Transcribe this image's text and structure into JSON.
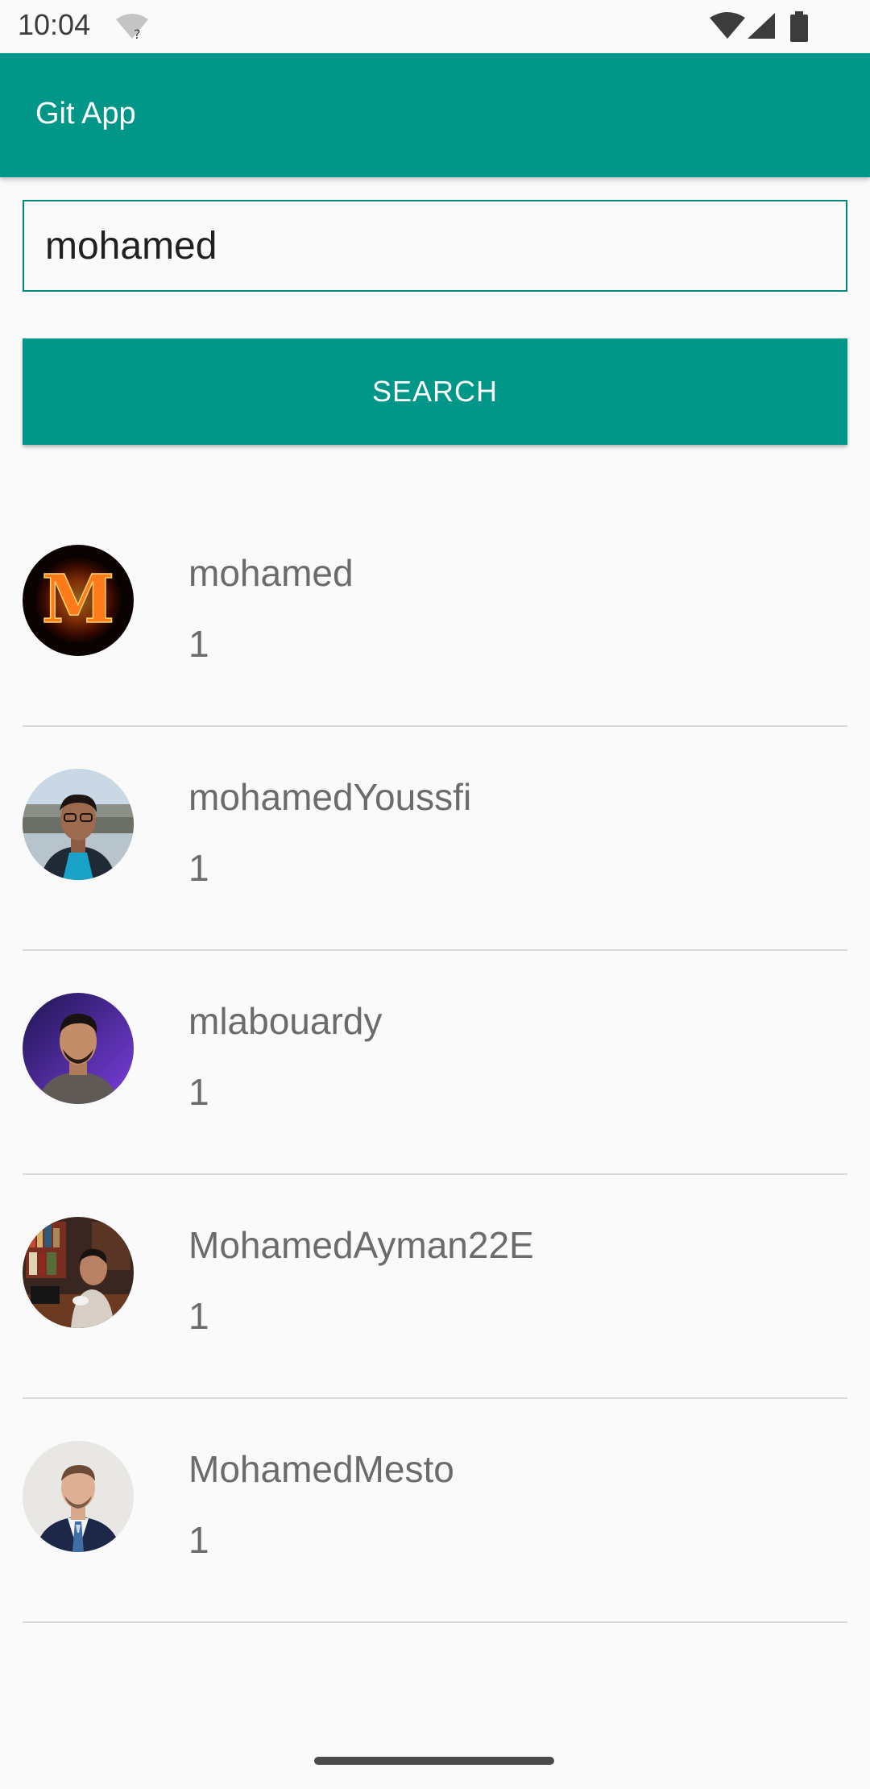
{
  "status_bar": {
    "time": "10:04",
    "icons": [
      "wifi-question-icon",
      "wifi-icon",
      "signal-icon",
      "battery-icon"
    ]
  },
  "app_bar": {
    "title": "Git App"
  },
  "search": {
    "value": "mohamed",
    "button_label": "SEARCH"
  },
  "results": [
    {
      "login": "mohamed",
      "score": "1",
      "avatar": "fire-letter-m-avatar"
    },
    {
      "login": "mohamedYoussfi",
      "score": "1",
      "avatar": "person-glasses-avatar"
    },
    {
      "login": "mlabouardy",
      "score": "1",
      "avatar": "person-purple-background-avatar"
    },
    {
      "login": "MohamedAyman22E",
      "score": "1",
      "avatar": "person-bookshelf-avatar"
    },
    {
      "login": "MohamedMesto",
      "score": "1",
      "avatar": "person-suit-avatar"
    }
  ],
  "colors": {
    "primary": "#009688",
    "accent_border": "#00897b",
    "background": "#fafafa",
    "text_secondary": "#6b6b6b"
  }
}
